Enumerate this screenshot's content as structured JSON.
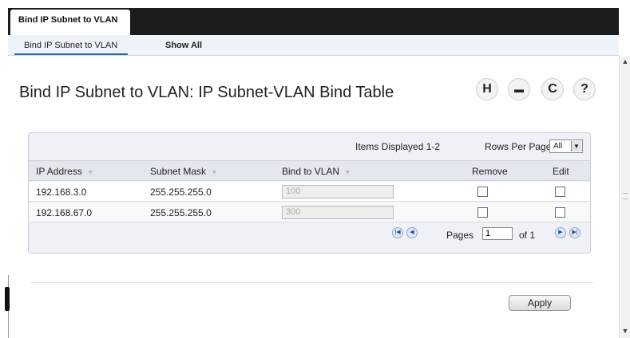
{
  "tabs": {
    "active_label": "Bind IP Subnet to VLAN"
  },
  "subnav": {
    "items": [
      {
        "label": "Bind IP Subnet to VLAN"
      },
      {
        "label": "Show All"
      }
    ]
  },
  "page": {
    "title": "Bind IP Subnet to VLAN: IP Subnet-VLAN Bind Table",
    "icons": [
      {
        "name": "save-icon",
        "glyph": "H"
      },
      {
        "name": "print-icon",
        "glyph": "▬"
      },
      {
        "name": "refresh-icon",
        "glyph": "C"
      },
      {
        "name": "help-icon",
        "glyph": "?"
      }
    ]
  },
  "table": {
    "items_displayed": "Items Displayed 1-2",
    "rows_per_page_label": "Rows Per Page",
    "rows_per_page_value": "All",
    "columns": [
      "IP Address",
      "Subnet Mask",
      "Bind to VLAN",
      "Remove",
      "Edit"
    ],
    "rows": [
      {
        "ip": "192.168.3.0",
        "mask": "255.255.255.0",
        "vlan": "100",
        "remove": false,
        "edit": false
      },
      {
        "ip": "192.168.67.0",
        "mask": "255.255.255.0",
        "vlan": "300",
        "remove": false,
        "edit": false
      }
    ],
    "pager": {
      "pages_label": "Pages",
      "current_page": "1",
      "of_label": "of 1"
    }
  },
  "actions": {
    "apply_label": "Apply"
  }
}
